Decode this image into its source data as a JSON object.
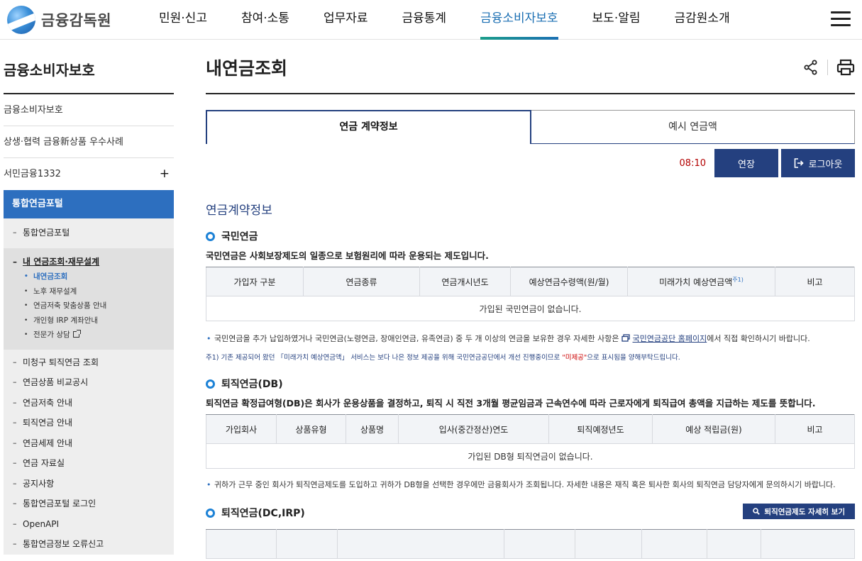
{
  "header": {
    "logo_text": "금융감독원",
    "nav": [
      "민원·신고",
      "참여·소통",
      "업무자료",
      "금융통계",
      "금융소비자보호",
      "보도·알림",
      "금감원소개"
    ],
    "active_nav_index": 4
  },
  "sidebar": {
    "title": "금융소비자보호",
    "links": [
      "금융소비자보호",
      "상생·협력 금융新상품 우수사례",
      "서민금융1332"
    ],
    "plus": "+",
    "active": "통합연금포털",
    "sub_top": "통합연금포털",
    "group_head": "내 연금조회·재무설계",
    "group_leaves": [
      "내연금조회",
      "노후 재무설계",
      "연금저축 맞춤상품 안내",
      "개인형 IRP 계좌안내",
      "전문가 상담"
    ],
    "sub_items": [
      "미청구 퇴직연금 조회",
      "연금상품 비교공시",
      "연금저축 안내",
      "퇴직연금 안내",
      "연금세제 안내",
      "연금 자료실",
      "공지사항",
      "통합연금포털 로그인",
      "OpenAPI",
      "통합연금정보 오류신고"
    ]
  },
  "main": {
    "title": "내연금조회",
    "tabs": [
      "연금 계약정보",
      "예시 연금액"
    ],
    "timer": "08:10",
    "extend_label": "연장",
    "logout_label": "로그아웃",
    "section_title": "연금계약정보",
    "national": {
      "title": "국민연금",
      "desc": "국민연금은 사회보장제도의 일종으로 보험원리에 따라 운용되는 제도입니다.",
      "headers": [
        "가입자 구분",
        "연금종류",
        "연금개시년도",
        "예상연금수령액(원/월)",
        "미래가치 예상연금액",
        "비고"
      ],
      "sup": "주1)",
      "empty": "가입된 국민연금이 없습니다.",
      "note_pre": "국민연금을 추가 납입하였거나 국민연금(노령연금, 장애인연금, 유족연금) 중 두 개 이상의 연금을 보유한 경우 자세한 사항은",
      "note_link": "국민연금공단 홈페이지",
      "note_post": "에서 직접 확인하시기 바랍니다.",
      "footnote_pre": "주1) 기존 제공되어 왔던 「미래가치 예상연금액」 서비스는 보다 나은 정보 제공을 위해 국민연금공단에서 개선 진행중이므로",
      "footnote_red": "\"미제공\"",
      "footnote_post": "으로 표시됨을 양해부탁드립니다."
    },
    "db": {
      "title": "퇴직연금(DB)",
      "desc": "퇴직연금 확정급여형(DB)은 회사가 운용상품을 결정하고, 퇴직 시 직전 3개월 평균임금과 근속연수에 따라 근로자에게 퇴직급여 총액을 지급하는 제도를 뜻합니다.",
      "headers": [
        "가입회사",
        "상품유형",
        "상품명",
        "입사(중간정산)연도",
        "퇴직예정년도",
        "예상 적립금(원)",
        "비고"
      ],
      "empty": "가입된 DB형 퇴직연금이 없습니다.",
      "note": "귀하가 근무 중인 회사가 퇴직연금제도를 도입하고 귀하가 DB형을 선택한 경우에만 금융회사가 조회됩니다. 자세한 내용은 재직 혹은 퇴사한 회사의 퇴직연금 담당자에게 문의하시기 바랍니다."
    },
    "dc": {
      "title": "퇴직연금(DC,IRP)",
      "button": "퇴직연금제도 자세히 보기"
    }
  }
}
